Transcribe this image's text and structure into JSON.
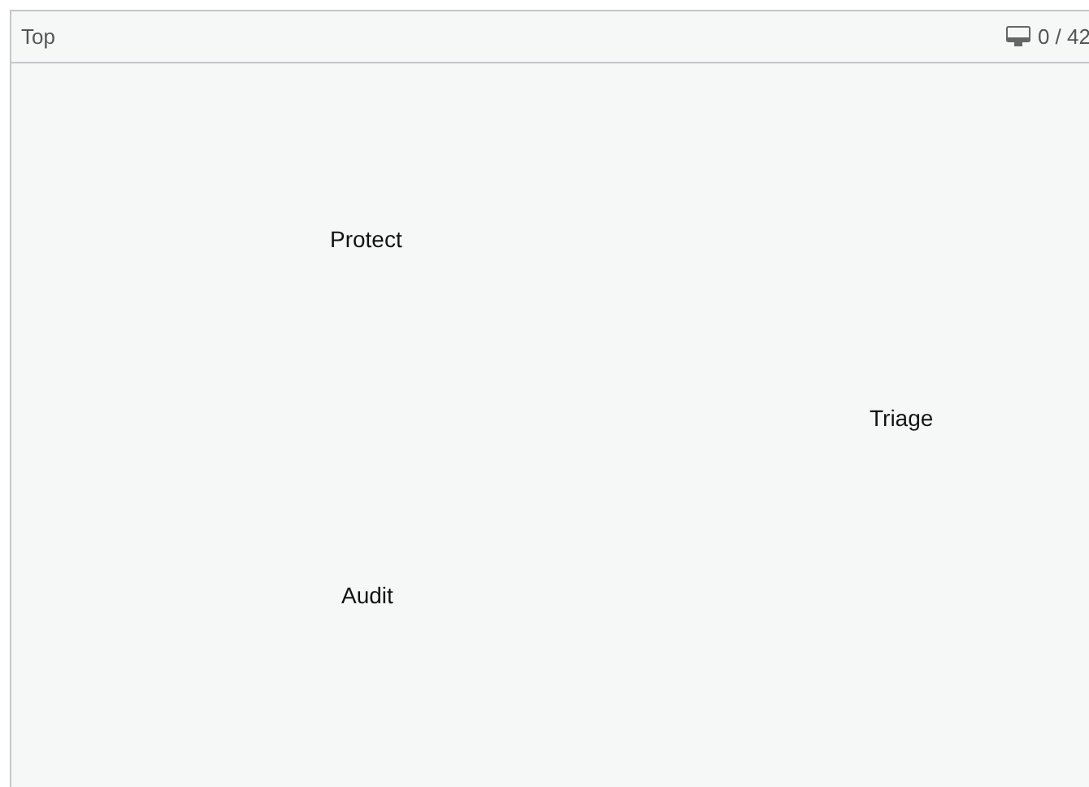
{
  "panel": {
    "title": "Top",
    "counter": "0 / 42"
  },
  "nodes": [
    {
      "label": "Protect"
    },
    {
      "label": "Triage"
    },
    {
      "label": "Audit"
    }
  ]
}
